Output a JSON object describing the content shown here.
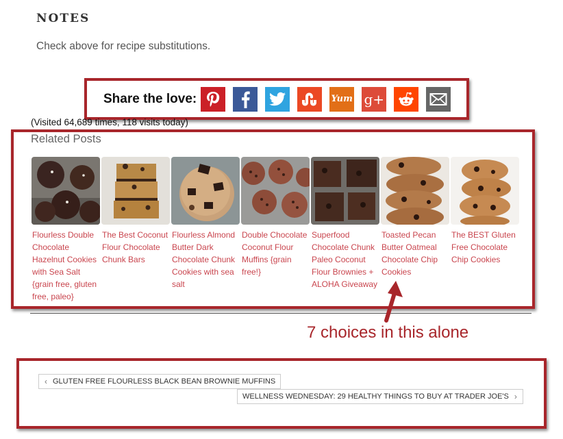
{
  "notes": {
    "title": "NOTES",
    "text": "Check above for recipe substitutions."
  },
  "share": {
    "label": "Share the love:",
    "buttons": [
      {
        "name": "pinterest",
        "color": "#cb2027",
        "icon": "pinterest-icon"
      },
      {
        "name": "facebook",
        "color": "#3b5998",
        "icon": "facebook-icon"
      },
      {
        "name": "twitter",
        "color": "#2fa4e0",
        "icon": "twitter-icon"
      },
      {
        "name": "stumbleupon",
        "color": "#eb4924",
        "icon": "stumbleupon-icon"
      },
      {
        "name": "yummly",
        "color": "#e26f17",
        "icon": "yummly-icon",
        "text": "Yum"
      },
      {
        "name": "google-plus",
        "color": "#dd4b39",
        "icon": "google-plus-icon",
        "text": "g+"
      },
      {
        "name": "reddit",
        "color": "#ff4500",
        "icon": "reddit-icon"
      },
      {
        "name": "email",
        "color": "#666666",
        "icon": "email-icon"
      }
    ]
  },
  "visited": "(Visited 64,689 times, 118 visits today)",
  "related": {
    "title": "Related Posts",
    "link_color": "#c9454e",
    "posts": [
      {
        "title": "Flourless Double Chocolate Hazelnut Cookies with Sea Salt {grain free, gluten free, paleo}"
      },
      {
        "title": "The Best Coconut Flour Chocolate Chunk Bars"
      },
      {
        "title": "Flourless Almond Butter Dark Chocolate Chunk Cookies with sea salt"
      },
      {
        "title": "Double Chocolate Coconut Flour Muffins {grain free!}"
      },
      {
        "title": "Superfood Chocolate Chunk Paleo Coconut Flour Brownies + ALOHA Giveaway"
      },
      {
        "title": "Toasted Pecan Butter Oatmeal Chocolate Chip Cookies"
      },
      {
        "title": "The BEST Gluten Free Chocolate Chip Cookies"
      }
    ]
  },
  "annotation": {
    "text": "7 choices in this alone",
    "color": "#a8262b"
  },
  "post_nav": {
    "prev_label": "GLUTEN FREE FLOURLESS BLACK BEAN BROWNIE MUFFINS",
    "next_label": "WELLNESS WEDNESDAY: 29 HEALTHY THINGS TO BUY AT TRADER JOE'S"
  }
}
